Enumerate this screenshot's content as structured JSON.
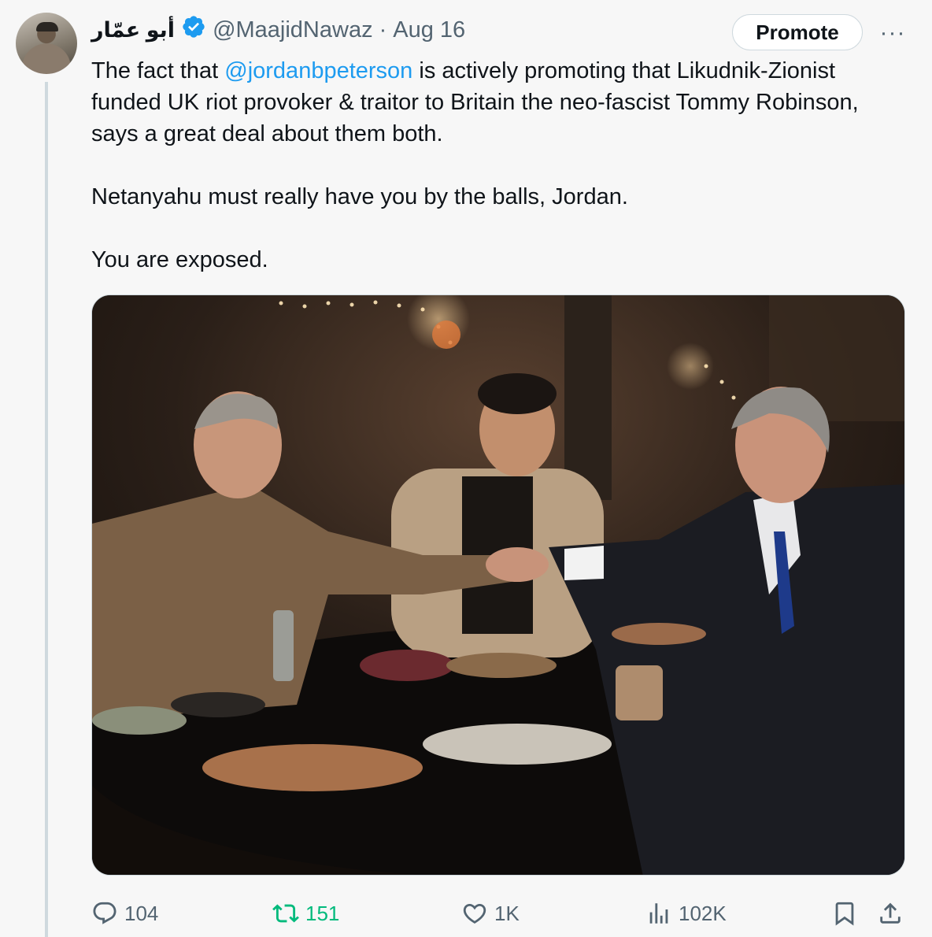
{
  "tweet": {
    "display_name": "أبو عمّار",
    "handle": "@MaajidNawaz",
    "separator": "·",
    "date": "Aug 16",
    "promote_label": "Promote",
    "more_label": "···",
    "text_segments": {
      "p1_prefix": "The fact that ",
      "mention": "@jordanbpeterson",
      "p1_suffix": " is actively promoting that Likudnik-Zionist funded UK riot provoker & traitor to Britain the neo-fascist Tommy Robinson, says a great deal about them both.",
      "p2": "Netanyahu must really have you by the balls, Jordan.",
      "p3": "You are exposed."
    }
  },
  "actions": {
    "reply_count": "104",
    "retweet_count": "151",
    "like_count": "1K",
    "views_count": "102K"
  },
  "icons": {
    "verified": "verified-badge-icon",
    "reply": "reply-icon",
    "retweet": "retweet-icon",
    "like": "heart-icon",
    "views": "analytics-icon",
    "bookmark": "bookmark-icon",
    "share": "share-icon"
  },
  "colors": {
    "accent": "#1d9bf0",
    "retweet_active": "#00ba7c",
    "muted": "#536471"
  }
}
